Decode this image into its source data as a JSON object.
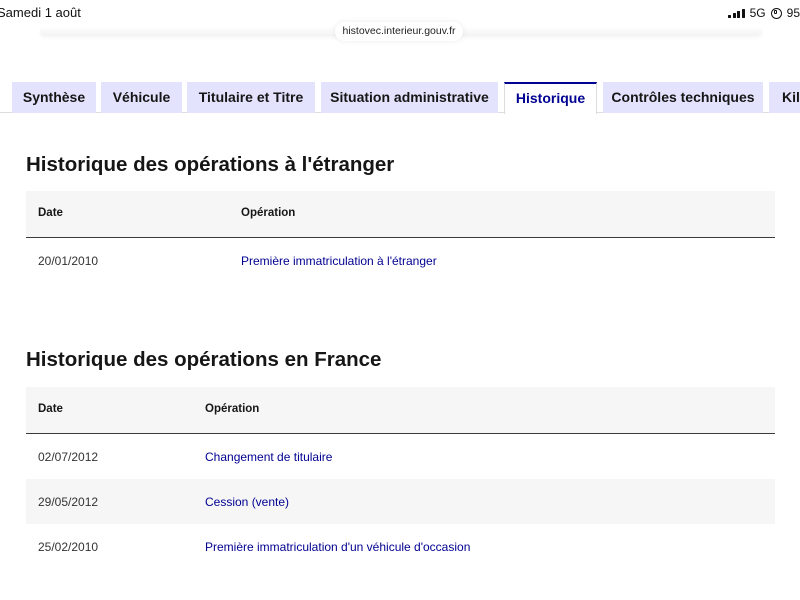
{
  "status_bar": {
    "time": "Samedi 1 août",
    "network": "5G",
    "battery": "95"
  },
  "browser": {
    "url": "histovec.interieur.gouv.fr"
  },
  "tabs": [
    {
      "label": "Synthèse"
    },
    {
      "label": "Véhicule"
    },
    {
      "label": "Titulaire et Titre"
    },
    {
      "label": "Situation administrative"
    },
    {
      "label": "Historique"
    },
    {
      "label": "Contrôles techniques"
    },
    {
      "label": "Kilométrage"
    }
  ],
  "active_tab": "Historique",
  "foreign_section": {
    "title": "Historique des opérations à l'étranger",
    "headers": {
      "date": "Date",
      "operation": "Opération"
    },
    "rows": [
      {
        "date": "20/01/2010",
        "operation": "Première immatriculation à l'étranger"
      }
    ]
  },
  "france_section": {
    "title": "Historique des opérations en France",
    "headers": {
      "date": "Date",
      "operation": "Opération"
    },
    "rows": [
      {
        "date": "02/07/2012",
        "operation": "Changement de titulaire"
      },
      {
        "date": "29/05/2012",
        "operation": "Cession (vente)"
      },
      {
        "date": "25/02/2010",
        "operation": "Première immatriculation d'un véhicule d'occasion"
      }
    ]
  },
  "colors": {
    "accent": "#000091",
    "tab_background": "#e3e3fd",
    "header_background": "#f6f6f6"
  }
}
